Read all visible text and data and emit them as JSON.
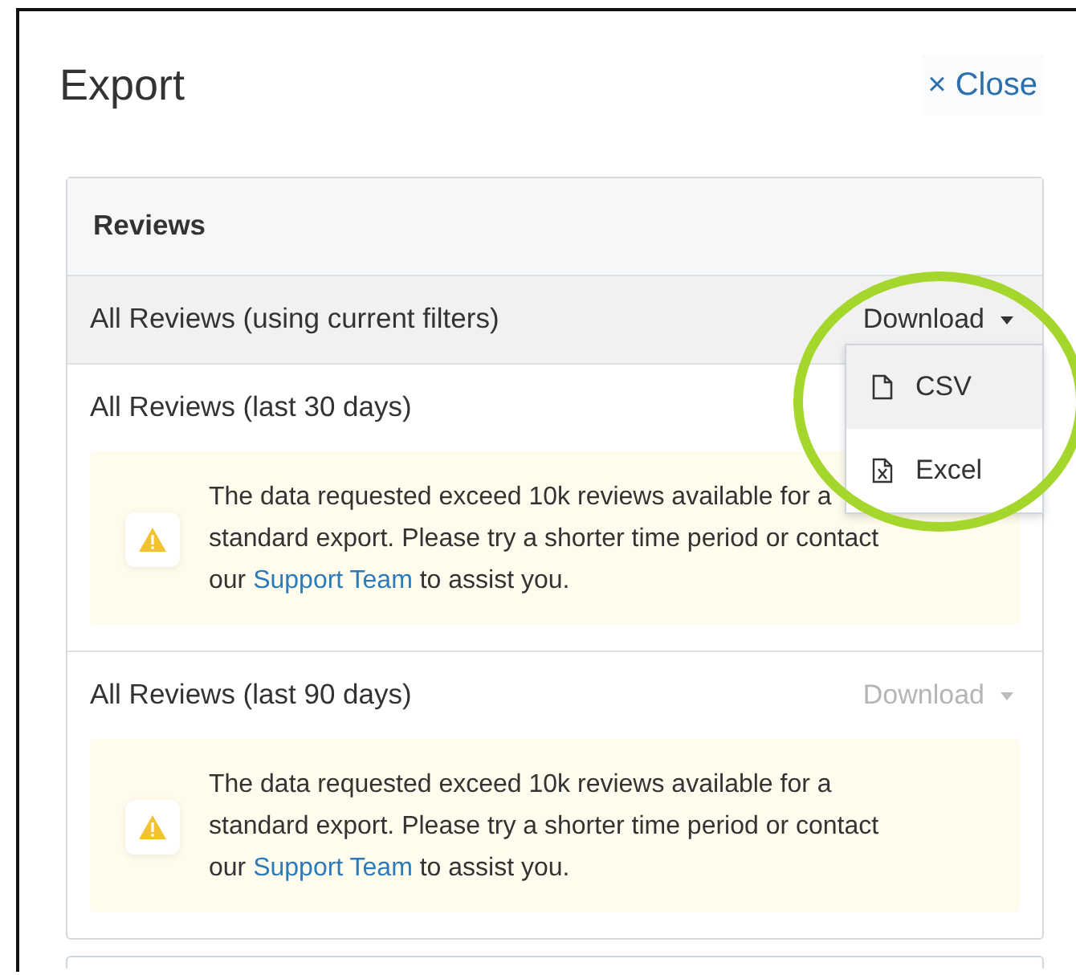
{
  "dialog": {
    "title": "Export",
    "close": {
      "icon": "×",
      "label": "Close"
    }
  },
  "section": {
    "title": "Reviews",
    "rows": [
      {
        "label": "All Reviews (using current filters)",
        "highlighted": true,
        "download": {
          "label": "Download",
          "disabled": false,
          "expanded": true,
          "menu": [
            {
              "label": "CSV",
              "kind": "file",
              "selected": true
            },
            {
              "label": "Excel",
              "kind": "excel",
              "selected": false
            }
          ]
        }
      },
      {
        "label": "All Reviews (last 30 days)",
        "highlighted": false,
        "warning": {
          "before": "The data requested exceed 10k reviews available for a standard export. Please try a shorter time period or contact our ",
          "link": "Support Team",
          "after": " to assist you."
        }
      },
      {
        "label": "All Reviews (last 90 days)",
        "highlighted": false,
        "download": {
          "label": "Download",
          "disabled": true
        },
        "warning": {
          "before": "The data requested exceed 10k reviews available for a standard export. Please try a shorter time period or contact our ",
          "link": "Support Team",
          "after": " to assist you."
        }
      }
    ]
  }
}
